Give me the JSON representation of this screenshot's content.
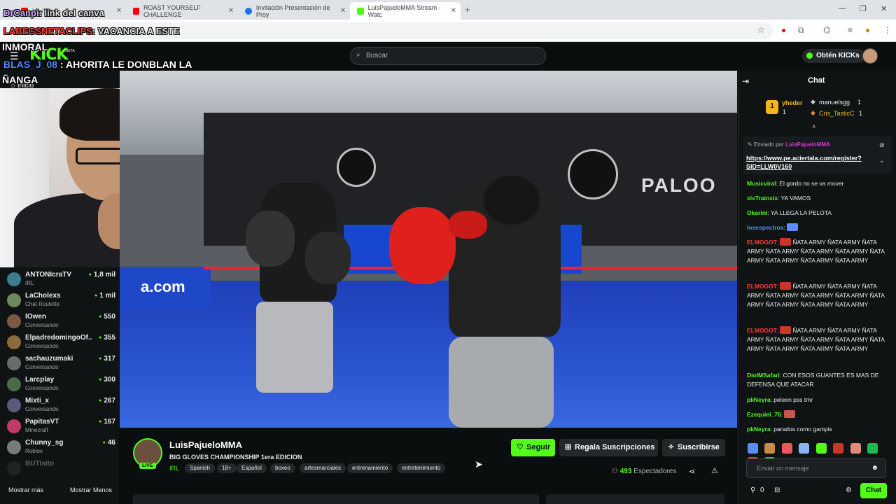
{
  "browser": {
    "tabs": [
      {
        "label": "YouTube",
        "favicon_color": "#ff0000"
      },
      {
        "label": "ROAST YOURSELF CHALLENGE",
        "favicon_color": "#ff0000"
      },
      {
        "label": "Invitación Presentación de Proy",
        "favicon_color": "#1a73e8"
      },
      {
        "label": "LuisPajueloMMA Stream - Watc",
        "favicon_color": "#53fc18"
      }
    ],
    "new_tab": "+",
    "window_controls": {
      "minimize": "—",
      "restore": "❐",
      "close": "✕"
    }
  },
  "overlay": {
    "line1_user": "DrCanpi",
    "line1_text": ": link del canva",
    "line2_user": "LABEGSNETACLIPS",
    "line2_text": ": VACANCIA A ESTE",
    "line3": "INMORAL",
    "line4_user": "BLAS_J_08",
    "line4_text": " : AHORITA LE DONBLAN LA",
    "line5": "ÑANGA"
  },
  "kick": {
    "logo": "KICK",
    "logo_badge": "BETA",
    "search_placeholder": "Buscar",
    "get_kicks": "Obtén KICKs",
    "nav_home": "Inicio"
  },
  "sidebar": {
    "channels": [
      {
        "name": "ANTONIcraTV",
        "category": "IRL",
        "viewers": "1,8 mil",
        "avatar_color": "#3b7d8c"
      },
      {
        "name": "LaCholexs",
        "category": "Chat Roulette",
        "viewers": "1 mil",
        "avatar_color": "#6c8a5a"
      },
      {
        "name": "lOwen",
        "category": "Conversando",
        "viewers": "550",
        "avatar_color": "#7a5a44"
      },
      {
        "name": "ElpadredomingoOf...",
        "category": "Conversando",
        "viewers": "355",
        "avatar_color": "#8a6a3a"
      },
      {
        "name": "sachauzumaki",
        "category": "Conversando",
        "viewers": "317",
        "avatar_color": "#6a6a6a"
      },
      {
        "name": "Larcplay",
        "category": "Conversando",
        "viewers": "300",
        "avatar_color": "#4a6a4a"
      },
      {
        "name": "Mixti_x",
        "category": "Conversando",
        "viewers": "267",
        "avatar_color": "#5a5a7a"
      },
      {
        "name": "PapitasVT",
        "category": "Minecraft",
        "viewers": "167",
        "avatar_color": "#c23a6a"
      },
      {
        "name": "Chunny_sg",
        "category": "Roblox",
        "viewers": "46",
        "avatar_color": "#7a7a7a"
      },
      {
        "name": "BUTIsito",
        "category": "",
        "viewers": "",
        "avatar_color": "#444444"
      }
    ],
    "show_more": "Mostrar más",
    "show_less": "Mostrar Menos"
  },
  "stream": {
    "banner_text": "PALOO",
    "ring_text": "a.com"
  },
  "channel": {
    "name": "LuisPajueloMMA",
    "live": "LIVE",
    "title": "BIG GLOVES CHAMPIONSHIP 1era EDICION",
    "category": "IRL",
    "tags": [
      "Spanish",
      "18+",
      "Español",
      "boxeo",
      "artesmarciales",
      "entrenamiento",
      "entretenimiento"
    ],
    "follow": "Seguir",
    "gift_subs": "Regala Suscripciones",
    "subscribe": "Suscribirse",
    "viewer_count": "493",
    "viewer_label": "Espectadores"
  },
  "chat": {
    "title": "Chat",
    "leaderboard": [
      {
        "rank": "1",
        "name": "yheder",
        "count": "1"
      },
      {
        "rank": "2",
        "name": "manuelsgg",
        "count": "1"
      },
      {
        "rank": "3",
        "name": "Cris_TasticC",
        "count": "1"
      }
    ],
    "pinned_label": "Enviado por",
    "pinned_user": "LuisPajueloMMA",
    "pinned_link": "https://www.pe.aciertala.com/register?SID=LLW0V160",
    "messages": [
      {
        "user": "Musicviral",
        "color": "#53fc18",
        "text": ": El gordo no se va mover"
      },
      {
        "user": "xlxTrainxlx",
        "color": "#53fc18",
        "text": ": YA VAMOS"
      },
      {
        "user": "OkarinI",
        "color": "#53fc18",
        "text": ": YA LLEGA LA PELOTA"
      },
      {
        "user": "losespectros",
        "color": "#5b8cff",
        "text": ":"
      },
      {
        "user": "ELMOGOT",
        "color": "#ff3b3b",
        "text": "ÑATA ARMY ÑATA ARMY ÑATA ARMY ÑATA ARMY ÑATA ARMY ÑATA ARMY ÑATA ARMY ÑATA ARMY ÑATA ARMY ÑATA ARMY"
      },
      {
        "user": "ELMOGOT",
        "color": "#ff3b3b",
        "text": "ÑATA ARMY ÑATA ARMY ÑATA ARMY ÑATA ARMY ÑATA ARMY ÑATA ARMY ÑATA ARMY ÑATA ARMY ÑATA ARMY ÑATA ARMY"
      },
      {
        "user": "ELMOGOT",
        "color": "#ff3b3b",
        "text": "ÑATA ARMY ÑATA ARMY ÑATA ARMY ÑATA ARMY ÑATA ARMY ÑATA ARMY ÑATA ARMY ÑATA ARMY ÑATA ARMY ÑATA ARMY"
      },
      {
        "user": "DiolMSafari",
        "color": "#53fc18",
        "text": ": CON ESOS GUANTES ES MAS DE DEFENSA QUE ATACAR"
      },
      {
        "user": "pkNeyra",
        "color": "#53fc18",
        "text": ": peleen pss tmr"
      },
      {
        "user": "Ezequiel_76",
        "color": "#53fc18",
        "text": ":"
      },
      {
        "user": "pkNeyra",
        "color": "#53fc18",
        "text": ": parados como gampis"
      }
    ],
    "input_placeholder": "Enviar un mensaje",
    "points": "0",
    "send": "Chat"
  },
  "colors": {
    "accent": "#53fc18",
    "bg": "#0b0e0f",
    "panel": "#0f1314"
  }
}
